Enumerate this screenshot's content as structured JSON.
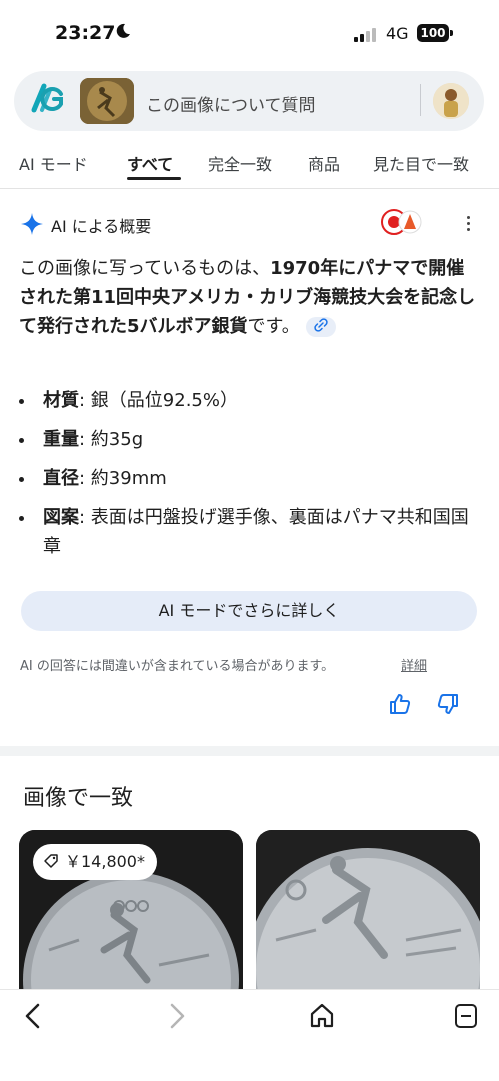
{
  "status": {
    "time": "23:27",
    "network": "4G",
    "battery": "100"
  },
  "search": {
    "query": "この画像について質問"
  },
  "tabs": [
    "AI モード",
    "すべて",
    "完全一致",
    "商品",
    "見た目で一致"
  ],
  "active_tab": "すべて",
  "ai": {
    "title": "AI による概要",
    "summary": {
      "p1": "この画像に写っているものは、",
      "p2": "1970年にパナマで開催された第11回中央アメリカ・カリブ海競技大会を記念して発行された5バルボア銀貨",
      "p3": "です。"
    },
    "bullets": [
      {
        "label": "材質",
        "value": ": 銀（品位92.5%）"
      },
      {
        "label": "重量",
        "value": ": 約35g"
      },
      {
        "label": "直径",
        "value": ": 約39mm"
      },
      {
        "label": "図案",
        "value": ": 表面は円盤投げ選手像、裏面はパナマ共和国国章"
      }
    ],
    "more_button": "AI モードでさらに詳しく",
    "disclaimer": "AI の回答には間違いが含まれている場合があります。",
    "detail_link": "詳細"
  },
  "matches": {
    "title": "画像で一致",
    "price": "￥14,800*"
  },
  "colors": {
    "accent": "#1a73e8",
    "chip_bg": "#e5ecf8"
  }
}
